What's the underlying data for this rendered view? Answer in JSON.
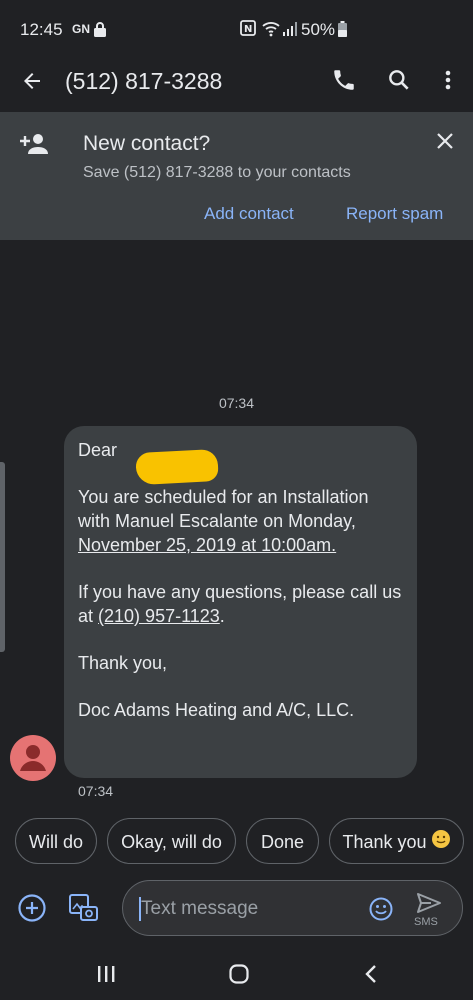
{
  "status": {
    "time": "12:45",
    "carrier": "GN",
    "battery": "50%"
  },
  "header": {
    "title": "(512) 817-3288"
  },
  "banner": {
    "title": "New contact?",
    "subtitle": "Save (512) 817-3288 to your contacts",
    "add_contact": "Add contact",
    "report_spam": "Report spam"
  },
  "conversation": {
    "timestamp_top": "07:34",
    "message": {
      "greeting": "Dear",
      "line1": "You are scheduled for an Installation with Manuel Escalante on Monday,",
      "line1_link": "November 25, 2019 at 10:00am.",
      "line2_pre": "If you have any questions, please call us at",
      "line2_link": "(210) 957-1123",
      "line2_post": ".",
      "line3": "Thank you,",
      "line4": "Doc Adams Heating and A/C, LLC."
    },
    "timestamp_msg": "07:34"
  },
  "smart_replies": [
    "Will do",
    "Okay, will do",
    "Done",
    "Thank you"
  ],
  "compose": {
    "placeholder": "Text message",
    "send_label": "SMS"
  },
  "colors": {
    "background": "#202124",
    "banner": "#3c4043",
    "accent": "#8ab4f8",
    "avatar": "#e57373",
    "redaction": "#f9c200"
  }
}
